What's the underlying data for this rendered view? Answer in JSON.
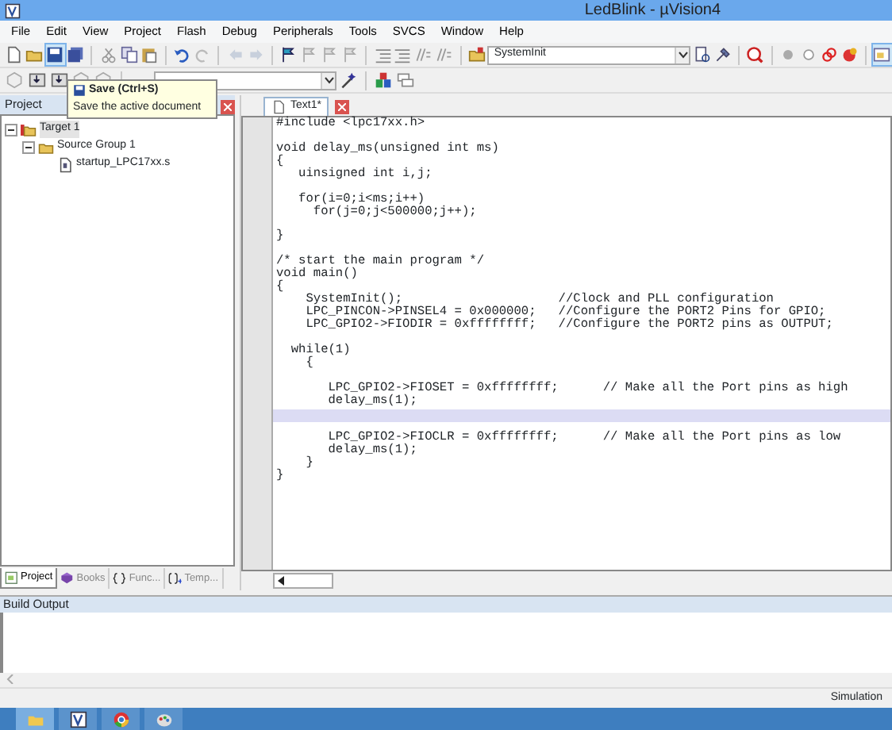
{
  "window": {
    "title": "LedBlink  - µVision4"
  },
  "menu": [
    "File",
    "Edit",
    "View",
    "Project",
    "Flash",
    "Debug",
    "Peripherals",
    "Tools",
    "SVCS",
    "Window",
    "Help"
  ],
  "toolbar": {
    "function_combo": "SystemInit"
  },
  "tooltip": {
    "title": "Save (Ctrl+S)",
    "text": "Save the active document"
  },
  "project_panel": {
    "title": "Project",
    "tree": [
      {
        "label": "Target 1",
        "expanded": true,
        "selected": true,
        "children": [
          {
            "label": "Source Group 1",
            "expanded": true,
            "selected": false,
            "children": [
              {
                "label": "startup_LPC17xx.s",
                "selected": false
              }
            ]
          }
        ]
      }
    ],
    "tabs": [
      {
        "label": "Project",
        "selected": true
      },
      {
        "label": "Books",
        "selected": false
      },
      {
        "label": "Func...",
        "selected": false
      },
      {
        "label": "Temp...",
        "selected": false
      }
    ]
  },
  "editor": {
    "tabs": [
      {
        "label": "Text1*",
        "selected": true
      }
    ],
    "lines": [
      {
        "text": "#include <lpc17xx.h>",
        "selected": false
      },
      {
        "selected": false
      },
      {
        "text": "void delay_ms(unsigned int ms)",
        "selected": false
      },
      {
        "text": "{",
        "selected": false
      },
      {
        "text": "   uinsigned int i,j;",
        "selected": false
      },
      {
        "selected": false
      },
      {
        "text": "   for(i=0;i<ms;i++)",
        "selected": false
      },
      {
        "text": "     for(j=0;j<500000;j++);",
        "selected": false
      },
      {
        "selected": false
      },
      {
        "text": "}",
        "selected": false
      },
      {
        "selected": false
      },
      {
        "text": "/* start the main program */",
        "selected": false
      },
      {
        "text": "void main()",
        "selected": false
      },
      {
        "text": "{",
        "selected": false
      },
      {
        "text": "    SystemInit();                     //Clock and PLL configuration",
        "selected": false
      },
      {
        "text": "    LPC_PINCON->PINSEL4 = 0x000000;   //Configure the PORT2 Pins for GPIO;",
        "selected": false
      },
      {
        "text": "    LPC_GPIO2->FIODIR = 0xffffffff;   //Configure the PORT2 pins as OUTPUT;",
        "selected": false
      },
      {
        "selected": false
      },
      {
        "text": "  while(1)",
        "selected": false
      },
      {
        "text": "    {",
        "selected": false
      },
      {
        "selected": false
      },
      {
        "text": "       LPC_GPIO2->FIOSET = 0xffffffff;      // Make all the Port pins as high",
        "selected": false
      },
      {
        "text": "       delay_ms(1);",
        "selected": false
      },
      {
        "selected": true
      },
      {
        "selected": false
      },
      {
        "text": "       LPC_GPIO2->FIOCLR = 0xffffffff;      // Make all the Port pins as low",
        "selected": false
      },
      {
        "text": "       delay_ms(1);",
        "selected": false
      },
      {
        "text": "    }",
        "selected": false
      },
      {
        "text": "}",
        "selected": false
      }
    ]
  },
  "build_output": {
    "title": "Build Output"
  },
  "status_bar": {
    "mode": "Simulation"
  }
}
